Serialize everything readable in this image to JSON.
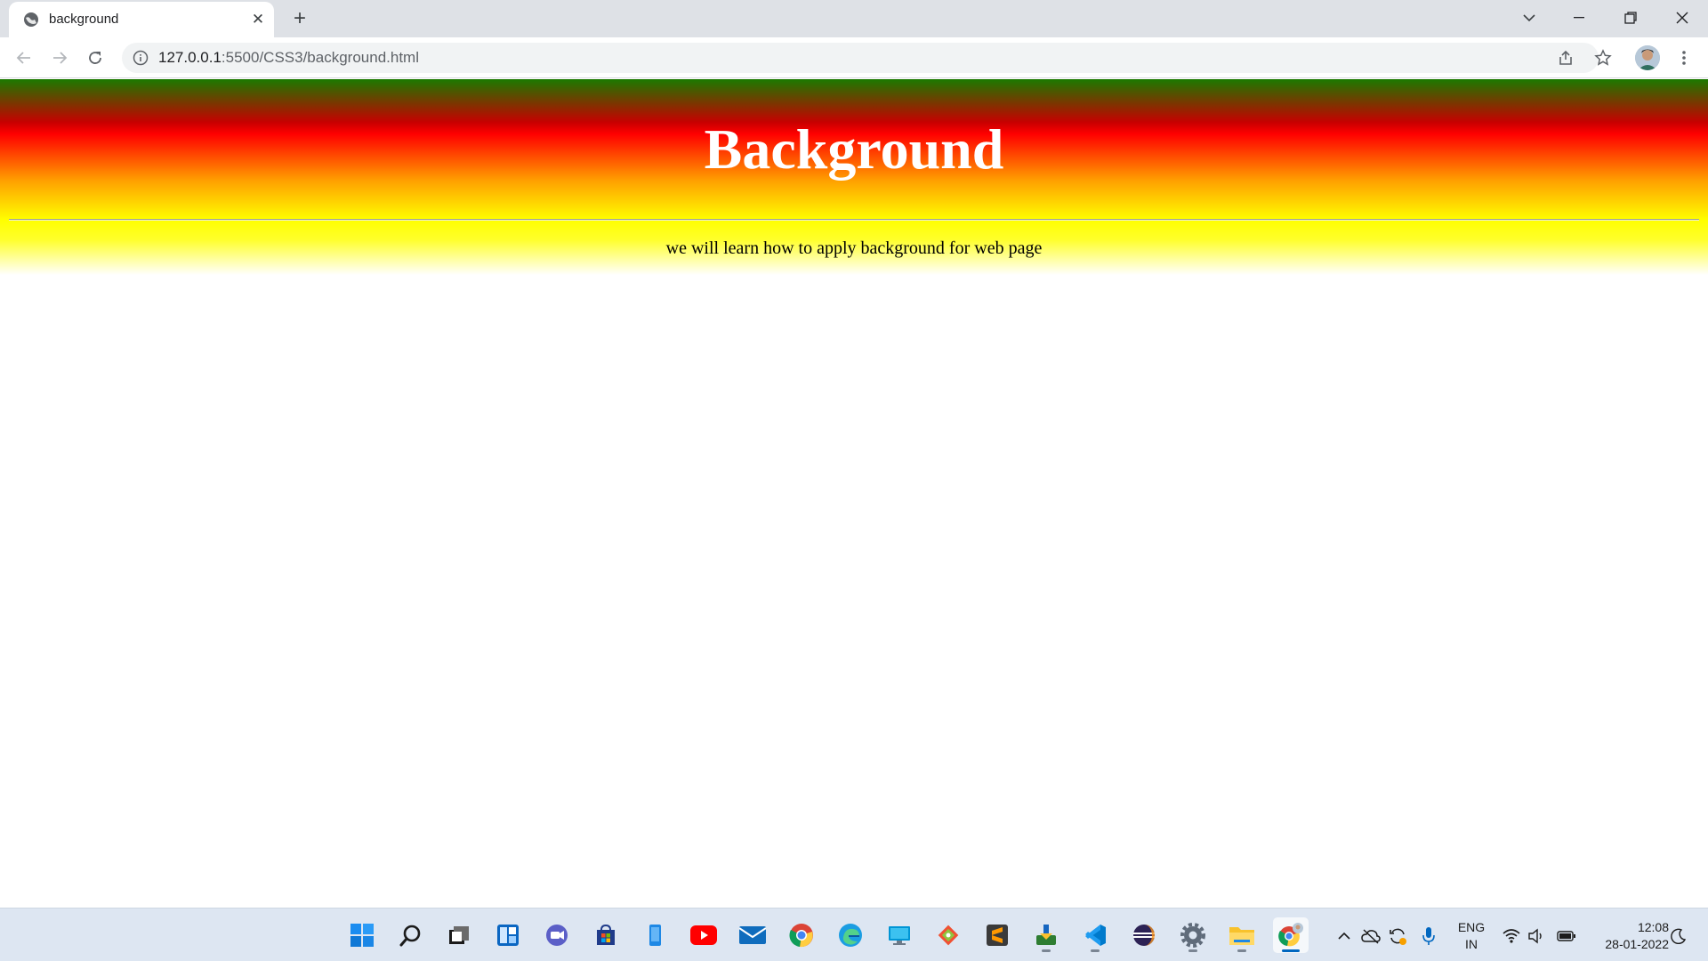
{
  "browser": {
    "tab": {
      "title": "background",
      "close_glyph": "✕"
    },
    "new_tab_glyph": "+",
    "address": {
      "host": "127.0.0.1",
      "rest": ":5500/CSS3/background.html"
    }
  },
  "page": {
    "heading": "Background",
    "paragraph": "we will learn how to apply background for web page",
    "gradient_colors": [
      "#1b7a00",
      "#ff0000",
      "#ffa100",
      "#ffff00",
      "#ffffff"
    ]
  },
  "taskbar": {
    "apps": [
      "start-icon",
      "search-icon",
      "task-view-icon",
      "widgets-icon",
      "chat-icon",
      "store-icon",
      "phone-link-icon",
      "youtube-icon",
      "mail-icon",
      "chrome-icon",
      "edge-icon",
      "remote-desktop-icon",
      "git-icon",
      "sublime-text-icon",
      "installer-icon",
      "vscode-icon",
      "eclipse-icon",
      "settings-icon",
      "file-explorer-icon",
      "chrome-profile-icon"
    ],
    "language": {
      "line1": "ENG",
      "line2": "IN"
    },
    "clock": {
      "time": "12:08",
      "date": "28-01-2022"
    }
  }
}
